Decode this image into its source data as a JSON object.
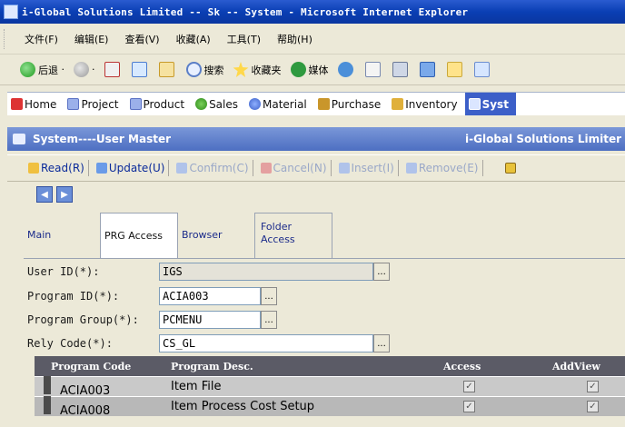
{
  "window": {
    "title": "i-Global Solutions Limited -- Sk -- System - Microsoft Internet Explorer"
  },
  "menubar": {
    "items": [
      "文件(F)",
      "编辑(E)",
      "查看(V)",
      "收藏(A)",
      "工具(T)",
      "帮助(H)"
    ]
  },
  "ie_toolbar": {
    "back": "后退",
    "search": "搜索",
    "favorites": "收藏夹",
    "media": "媒体"
  },
  "app_nav": {
    "tabs": [
      {
        "label": "Home",
        "icon": "home-icon"
      },
      {
        "label": "Project",
        "icon": "project-icon"
      },
      {
        "label": "Product",
        "icon": "product-icon"
      },
      {
        "label": "Sales",
        "icon": "sales-icon"
      },
      {
        "label": "Material",
        "icon": "material-icon"
      },
      {
        "label": "Purchase",
        "icon": "purchase-icon"
      },
      {
        "label": "Inventory",
        "icon": "inventory-icon"
      },
      {
        "label": "Syst",
        "icon": "system-icon",
        "active": true
      }
    ]
  },
  "page_header": {
    "title": "System----User Master",
    "company": "i-Global Solutions Limiter"
  },
  "actions": {
    "read": "Read(R)",
    "update": "Update(U)",
    "confirm": "Confirm(C)",
    "cancel": "Cancel(N)",
    "insert": "Insert(I)",
    "remove": "Remove(E)"
  },
  "form_tabs": {
    "main": "Main",
    "prg_access": "PRG Access",
    "browser": "Browser",
    "folder_access": "Folder Access"
  },
  "form": {
    "user_id_label": "User ID(*):",
    "user_id_value": "IGS",
    "program_id_label": "Program ID(*):",
    "program_id_value": "ACIA003",
    "program_group_label": "Program Group(*):",
    "program_group_value": "PCMENU",
    "rely_code_label": "Rely Code(*):",
    "rely_code_value": "CS_GL"
  },
  "grid": {
    "columns": [
      "Program Code",
      "Program Desc.",
      "Access",
      "AddView"
    ],
    "rows": [
      {
        "code": "ACIA003",
        "desc": "Item File",
        "access": true,
        "addview": true
      },
      {
        "code": "ACIA008",
        "desc": "Item Process Cost Setup",
        "access": true,
        "addview": true
      }
    ]
  },
  "colors": {
    "title_bar": "#0a3fb4",
    "active_tab": "#3c5fc8",
    "page_header": "#4d6fc2",
    "grid_header": "#5b5b66"
  }
}
